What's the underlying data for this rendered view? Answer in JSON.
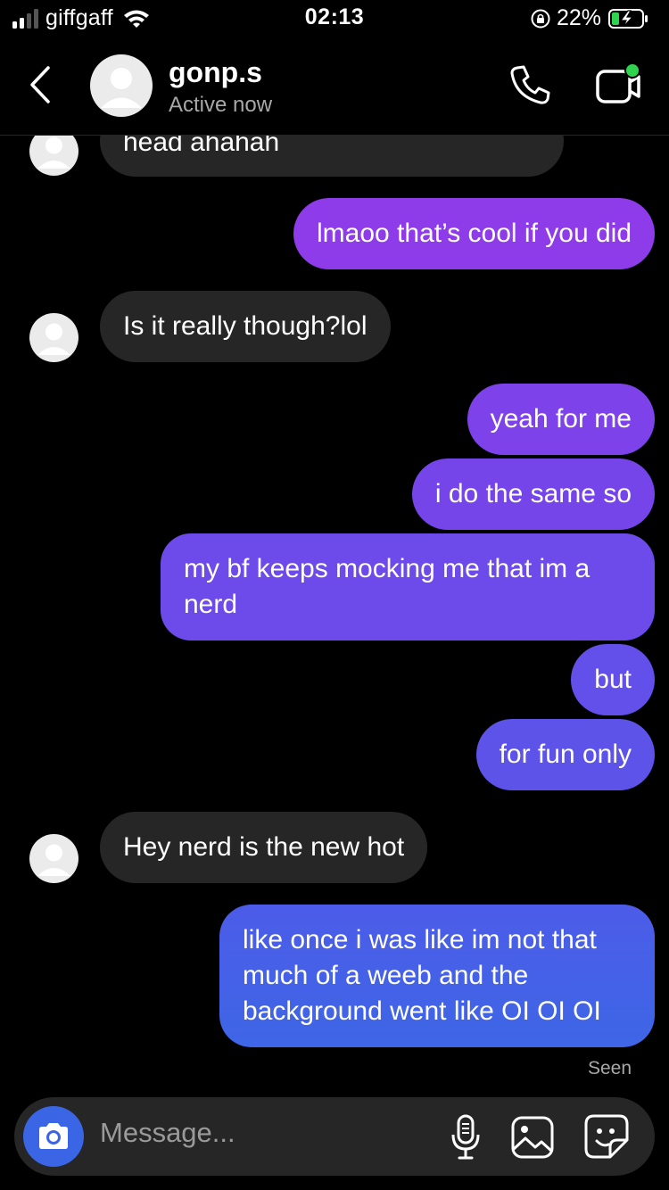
{
  "status_bar": {
    "carrier": "giffgaff",
    "time": "02:13",
    "battery": "22%"
  },
  "header": {
    "name": "gonp.s",
    "status": "Active now"
  },
  "messages": [
    {
      "from": "them",
      "text": "head ahahah"
    },
    {
      "from": "me",
      "text": "lmaoo that’s cool if you did"
    },
    {
      "from": "them",
      "text": "Is it really though?lol"
    },
    {
      "from": "me",
      "text": "yeah for me"
    },
    {
      "from": "me",
      "text": "i do the same so"
    },
    {
      "from": "me",
      "text": "my bf keeps mocking me that im a nerd"
    },
    {
      "from": "me",
      "text": "but"
    },
    {
      "from": "me",
      "text": "for fun only"
    },
    {
      "from": "them",
      "text": "Hey nerd is the new hot"
    },
    {
      "from": "me",
      "text": "like once i was like im not that much of a weeb and the background went like OI OI OI"
    }
  ],
  "seen_label": "Seen",
  "composer": {
    "placeholder": "Message..."
  },
  "icons": {
    "back": "chevron-left-icon",
    "call": "phone-icon",
    "video": "video-camera-icon",
    "camera": "camera-icon",
    "mic": "microphone-icon",
    "gallery": "image-icon",
    "sticker": "sticker-icon"
  },
  "colors": {
    "incoming_bubble": "#262626",
    "outgoing_gradient_top": "#8e3bea",
    "outgoing_gradient_bottom": "#3e66e6",
    "online_dot": "#2fd34d",
    "camera_button": "#3a66e5"
  }
}
